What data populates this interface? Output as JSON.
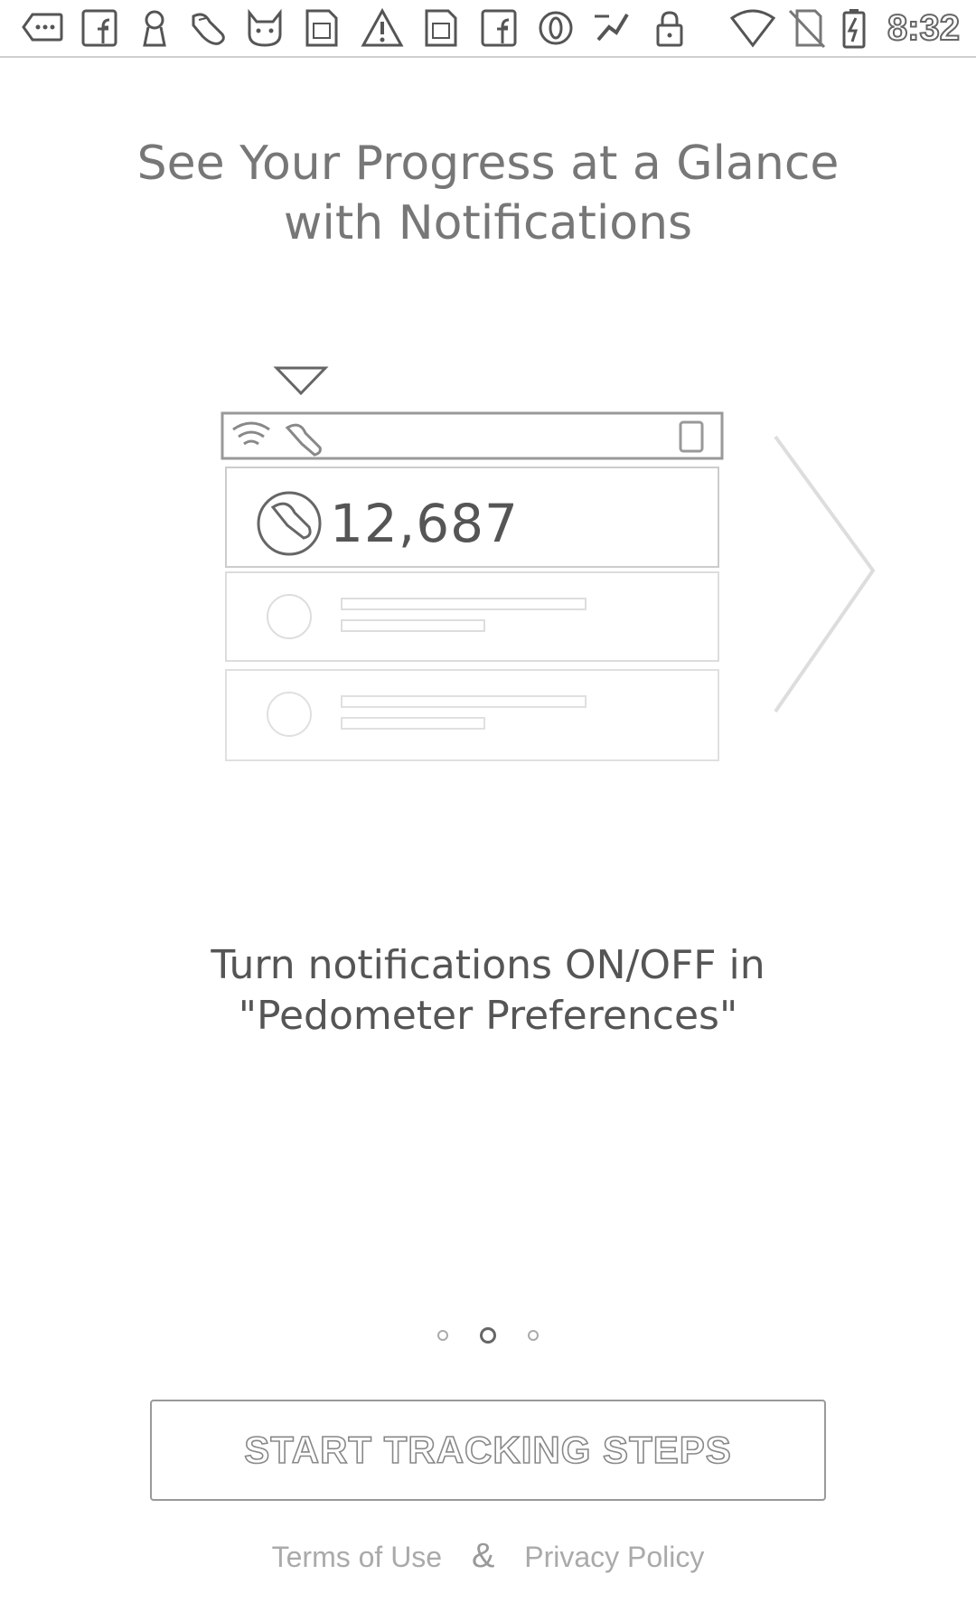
{
  "status_bar": {
    "time": "8:32",
    "icons": [
      "chat-more-icon",
      "facebook-icon",
      "keyhole-icon",
      "shoe-icon",
      "cat-icon",
      "sim-card-icon",
      "warning-icon",
      "sim-card-icon",
      "facebook-icon",
      "opera-icon",
      "fit-icon",
      "lock-icon",
      "wifi-icon",
      "no-sim-icon",
      "battery-charging-icon"
    ]
  },
  "onboarding": {
    "title_line1": "See Your Progress at a Glance",
    "title_line2": "with Notifications",
    "illustration_count": "12,687",
    "subtitle_line1": "Turn notifications ON/OFF in",
    "subtitle_line2": "\"Pedometer Preferences\"",
    "page_indicator": {
      "total": 3,
      "current": 2
    }
  },
  "cta": {
    "label": "START TRACKING STEPS"
  },
  "footer": {
    "terms": "Terms of Use",
    "separator": "&",
    "privacy": "Privacy Policy"
  }
}
